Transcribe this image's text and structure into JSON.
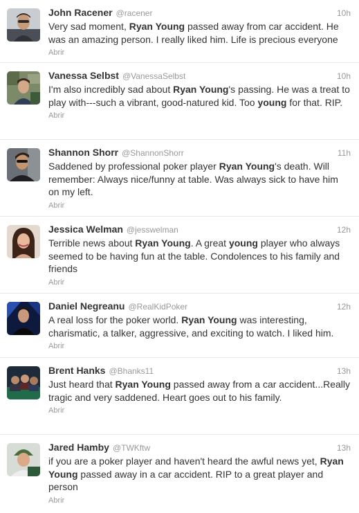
{
  "tweets": [
    {
      "name": "John Racener",
      "handle": "@racener",
      "time": "10h",
      "action": "Abrir",
      "avatar": "John Racener profile photo",
      "text": [
        {
          "t": "Very sad moment, ",
          "b": false
        },
        {
          "t": "Ryan Young",
          "b": true
        },
        {
          "t": " passed away from car accident. He was an amazing person. I really liked him. Life is precious everyone",
          "b": false
        }
      ]
    },
    {
      "name": "Vanessa Selbst",
      "handle": "@VanessaSelbst",
      "time": "10h",
      "action": "Abrir",
      "avatar": "Vanessa Selbst profile photo",
      "text": [
        {
          "t": "I'm also incredibly sad about ",
          "b": false
        },
        {
          "t": "Ryan Young",
          "b": true
        },
        {
          "t": "'s passing. He was a treat to play with---such a vibrant, good-natured kid. Too ",
          "b": false
        },
        {
          "t": "young",
          "b": true
        },
        {
          "t": " for that. RIP.",
          "b": false
        }
      ]
    },
    {
      "name": "Shannon Shorr",
      "handle": "@ShannonShorr",
      "time": "11h",
      "action": "Abrir",
      "avatar": "Shannon Shorr profile photo",
      "text": [
        {
          "t": "Saddened by professional poker player ",
          "b": false
        },
        {
          "t": "Ryan Young",
          "b": true
        },
        {
          "t": "'s death. Will remember: Always nice/funny at table. Was always sick to have him on my left.",
          "b": false
        }
      ]
    },
    {
      "name": "Jessica Welman",
      "handle": "@jesswelman",
      "time": "12h",
      "action": "Abrir",
      "avatar": "Jessica Welman profile photo",
      "text": [
        {
          "t": "Terrible news about ",
          "b": false
        },
        {
          "t": "Ryan Young",
          "b": true
        },
        {
          "t": ". A great ",
          "b": false
        },
        {
          "t": "young",
          "b": true
        },
        {
          "t": " player who always seemed to be having fun at the table. Condolences to his family and friends",
          "b": false
        }
      ]
    },
    {
      "name": "Daniel Negreanu",
      "handle": "@RealKidPoker",
      "time": "12h",
      "action": "Abrir",
      "avatar": "Daniel Negreanu profile photo",
      "text": [
        {
          "t": "A real loss for the poker world. ",
          "b": false
        },
        {
          "t": "Ryan Young",
          "b": true
        },
        {
          "t": " was interesting, charismatic, a talker, aggressive, and exciting to watch. I liked him.",
          "b": false
        }
      ]
    },
    {
      "name": "Brent Hanks",
      "handle": "@Bhanks11",
      "time": "13h",
      "action": "Abrir",
      "avatar": "Brent Hanks profile photo",
      "text": [
        {
          "t": "Just heard that ",
          "b": false
        },
        {
          "t": "Ryan Young",
          "b": true
        },
        {
          "t": " passed away from a car accident...Really tragic and very saddened. Heart goes out to his family.",
          "b": false
        }
      ]
    },
    {
      "name": "Jared Hamby",
      "handle": "@TWKftw",
      "time": "13h",
      "action": "Abrir",
      "avatar": "Jared Hamby profile photo",
      "text": [
        {
          "t": "if you are a poker player and haven't heard the awful news yet, ",
          "b": false
        },
        {
          "t": "Ryan Young",
          "b": true
        },
        {
          "t": " passed away in a car accident. RIP to a great player and person",
          "b": false
        }
      ]
    }
  ]
}
